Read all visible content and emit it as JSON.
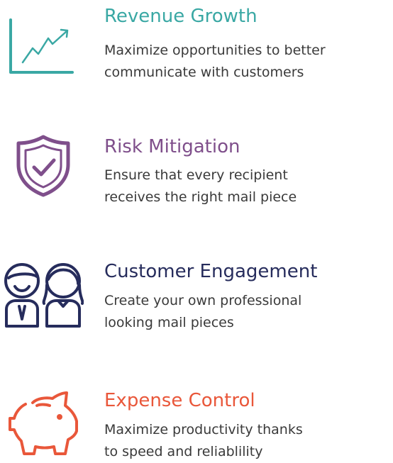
{
  "features": [
    {
      "title": "Revenue Growth",
      "lines": [
        "Maximize opportunities to better",
        "communicate with customers"
      ],
      "color": "#3aa8a4",
      "icon": "growth-chart-icon"
    },
    {
      "title": "Risk Mitigation",
      "lines": [
        "Ensure that every recipient",
        "receives the right mail piece"
      ],
      "color": "#7f4f8b",
      "icon": "shield-check-icon"
    },
    {
      "title": "Customer Engagement",
      "lines": [
        "Create your own professional",
        "looking mail pieces"
      ],
      "color": "#262c5c",
      "icon": "customers-icon"
    },
    {
      "title": "Expense Control",
      "lines": [
        "Maximize productivity thanks",
        "to speed and reliablility"
      ],
      "color": "#e9573a",
      "icon": "piggy-bank-icon"
    }
  ]
}
